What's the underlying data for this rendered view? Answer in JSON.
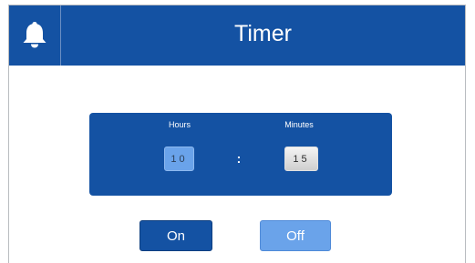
{
  "header": {
    "title": "Timer",
    "icon": "bell-icon"
  },
  "timer": {
    "hours_label": "Hours",
    "minutes_label": "Minutes",
    "hours_value": "10",
    "minutes_value": "15",
    "separator": ":"
  },
  "buttons": {
    "on_label": "On",
    "off_label": "Off"
  },
  "colors": {
    "primary": "#1452a3",
    "accent_light": "#6aa3ea",
    "background": "#ffffff"
  }
}
